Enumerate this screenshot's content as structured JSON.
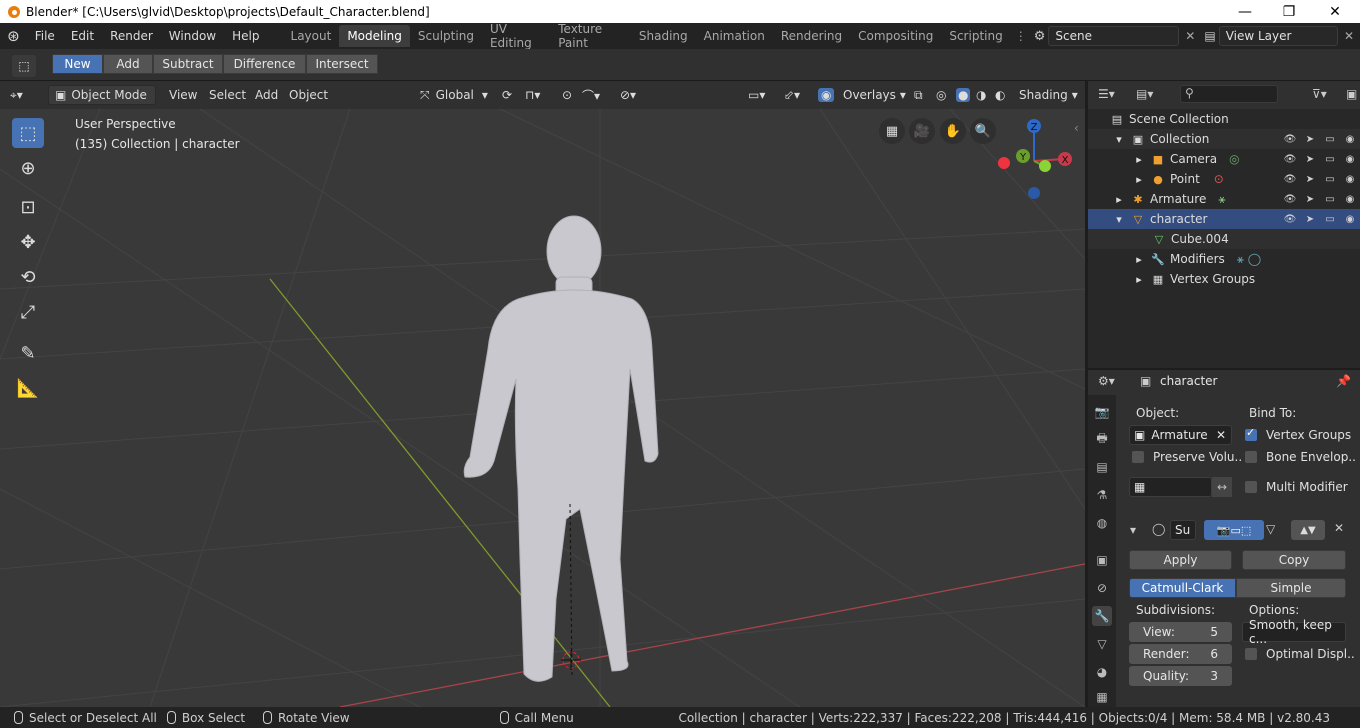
{
  "window": {
    "title": "Blender* [C:\\Users\\glvid\\Desktop\\projects\\Default_Character.blend]",
    "minimize": "—",
    "maximize": "❐",
    "close": "✕"
  },
  "menu": {
    "items": [
      "File",
      "Edit",
      "Render",
      "Window",
      "Help"
    ]
  },
  "workspaces": [
    "Layout",
    "Modeling",
    "Sculpting",
    "UV Editing",
    "Texture Paint",
    "Shading",
    "Animation",
    "Rendering",
    "Compositing",
    "Scripting"
  ],
  "active_workspace": "Modeling",
  "scene": {
    "name": "Scene",
    "view_layer": "View Layer"
  },
  "tool_settings": {
    "mode_buttons": [
      "New",
      "Add",
      "Subtract",
      "Difference",
      "Intersect"
    ],
    "active": "New"
  },
  "viewport_header": {
    "mode": "Object Mode",
    "menus": [
      "View",
      "Select",
      "Add",
      "Object"
    ],
    "orientation": "Global",
    "overlays": "Overlays",
    "shading": "Shading"
  },
  "viewport": {
    "perspective": "User Perspective",
    "collection_info": "(135) Collection | character"
  },
  "gizmo": {
    "z": "Z",
    "y": "Y",
    "x": "X"
  },
  "outliner": {
    "rows": [
      {
        "label": "Scene Collection"
      },
      {
        "label": "Collection"
      },
      {
        "label": "Camera"
      },
      {
        "label": "Point"
      },
      {
        "label": "Armature"
      },
      {
        "label": "character"
      },
      {
        "label": "Cube.004"
      },
      {
        "label": "Modifiers"
      },
      {
        "label": "Vertex Groups"
      }
    ]
  },
  "properties": {
    "object_name": "character",
    "object_label": "Object:",
    "object_value": "Armature",
    "bind_to_label": "Bind To:",
    "vertex_groups": "Vertex Groups",
    "preserve_volume": "Preserve Volu..",
    "bone_envelopes": "Bone Envelop..",
    "multi_modifier": "Multi Modifier",
    "modifier_name": "Su",
    "apply": "Apply",
    "copy": "Copy",
    "catmull_clark": "Catmull-Clark",
    "simple": "Simple",
    "subdivisions": "Subdivisions:",
    "options": "Options:",
    "view_label": "View:",
    "view_value": "5",
    "render_label": "Render:",
    "render_value": "6",
    "quality_label": "Quality:",
    "quality_value": "3",
    "smooth_option": "Smooth, keep c...",
    "optimal_display": "Optimal Displ.."
  },
  "status": {
    "select": "Select or Deselect All",
    "box_select": "Box Select",
    "rotate": "Rotate View",
    "call_menu": "Call Menu",
    "stats": "Collection | character | Verts:222,337 | Faces:222,208 | Tris:444,416 | Objects:0/4 | Mem: 58.4 MB | v2.80.43"
  }
}
